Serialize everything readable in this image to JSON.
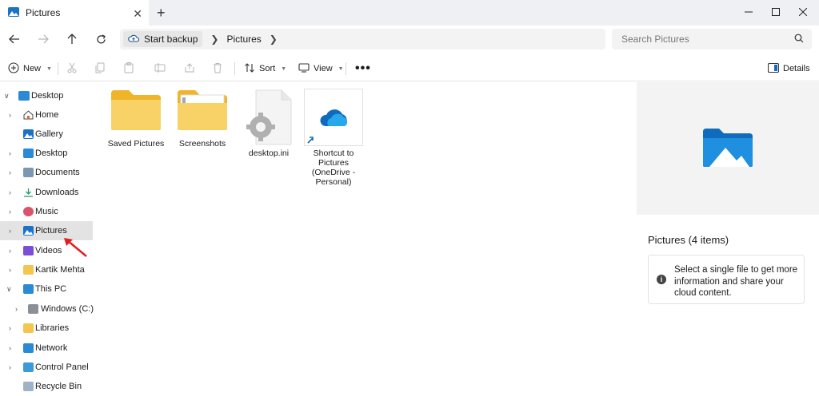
{
  "window": {
    "tab_title": "Pictures"
  },
  "address": {
    "backup_label": "Start backup",
    "current": "Pictures",
    "search_placeholder": "Search Pictures"
  },
  "commands": {
    "new_label": "New",
    "sort_label": "Sort",
    "view_label": "View",
    "details_label": "Details"
  },
  "sidebar": {
    "items": [
      {
        "label": "Desktop"
      },
      {
        "label": "Home"
      },
      {
        "label": "Gallery"
      },
      {
        "label": "Desktop"
      },
      {
        "label": "Documents"
      },
      {
        "label": "Downloads"
      },
      {
        "label": "Music"
      },
      {
        "label": "Pictures"
      },
      {
        "label": "Videos"
      },
      {
        "label": "Kartik Mehta"
      },
      {
        "label": "This PC"
      },
      {
        "label": "Windows (C:)"
      },
      {
        "label": "Libraries"
      },
      {
        "label": "Network"
      },
      {
        "label": "Control Panel"
      },
      {
        "label": "Recycle Bin"
      }
    ]
  },
  "files": [
    {
      "name": "Saved Pictures"
    },
    {
      "name": "Screenshots"
    },
    {
      "name": "desktop.ini"
    },
    {
      "name": "Shortcut to Pictures (OneDrive - Personal)"
    }
  ],
  "details_pane": {
    "title": "Pictures (4 items)",
    "info": "Select a single file to get more information and share your cloud content."
  },
  "colors": {
    "folder": "#f4c64f",
    "accent": "#0f6cbd",
    "selected": "#e3e3e3",
    "annotation_arrow": "#e02020"
  }
}
